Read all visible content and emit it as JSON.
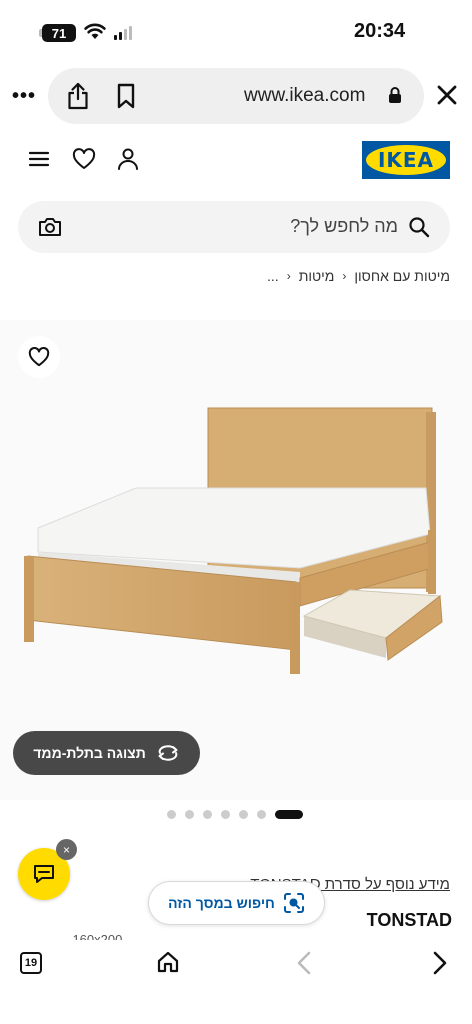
{
  "status_bar": {
    "battery": "71",
    "time": "20:34"
  },
  "browser": {
    "url": "www.ikea.com",
    "tab_count": "19"
  },
  "site": {
    "logo": "IKEA",
    "search_placeholder": "מה לחפש לך?",
    "breadcrumb": [
      {
        "label": "..."
      },
      {
        "label": "מיטות"
      },
      {
        "label": "מיטות עם אחסון"
      }
    ]
  },
  "product": {
    "view_3d_label": "תצוגה בתלת-ממד",
    "image_count": 7,
    "active_image_index": 6,
    "series_link": "מידע נוסף על סדרת TONSTAD",
    "visual_search_label": "חיפוש במסך הזה",
    "name": "TONSTAD",
    "sub_partial": "... 160x200 ..."
  },
  "chat": {
    "dismiss": "×"
  },
  "colors": {
    "ikea_blue": "#0058a3",
    "ikea_yellow": "#ffdb00",
    "chip_dark": "#484848"
  }
}
